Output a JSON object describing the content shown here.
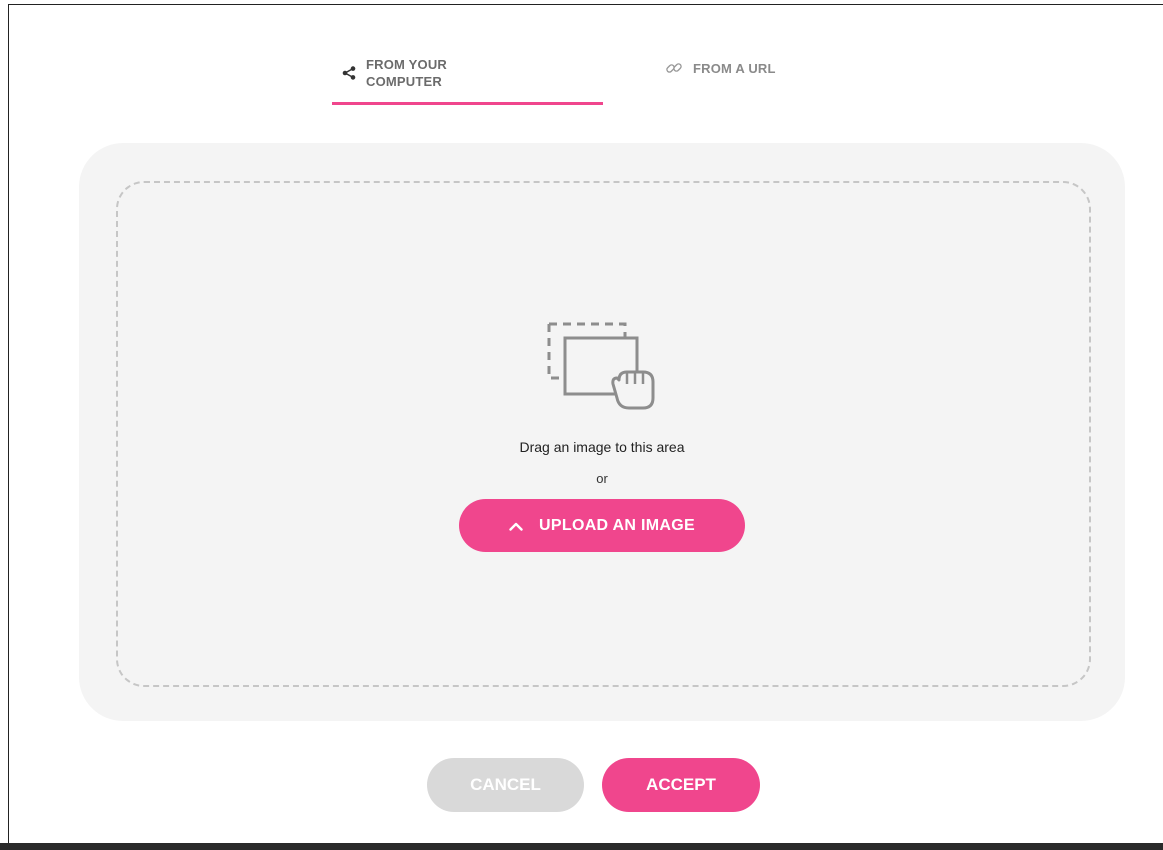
{
  "tabs": {
    "computer": {
      "label": "FROM YOUR\nCOMPUTER",
      "icon": "share-icon",
      "active": true
    },
    "url": {
      "label": "FROM A URL",
      "icon": "link-icon",
      "active": false
    }
  },
  "drop_zone": {
    "graphic_icon": "drag-image-icon",
    "drag_text": "Drag an image to this area",
    "or_text": "or",
    "upload_label": "UPLOAD AN IMAGE",
    "upload_icon": "chevron-up-icon"
  },
  "footer": {
    "cancel_label": "CANCEL",
    "accept_label": "ACCEPT"
  },
  "colors": {
    "accent": "#f0468d",
    "disabled": "#d9d9d9",
    "panel": "#f4f4f4"
  }
}
